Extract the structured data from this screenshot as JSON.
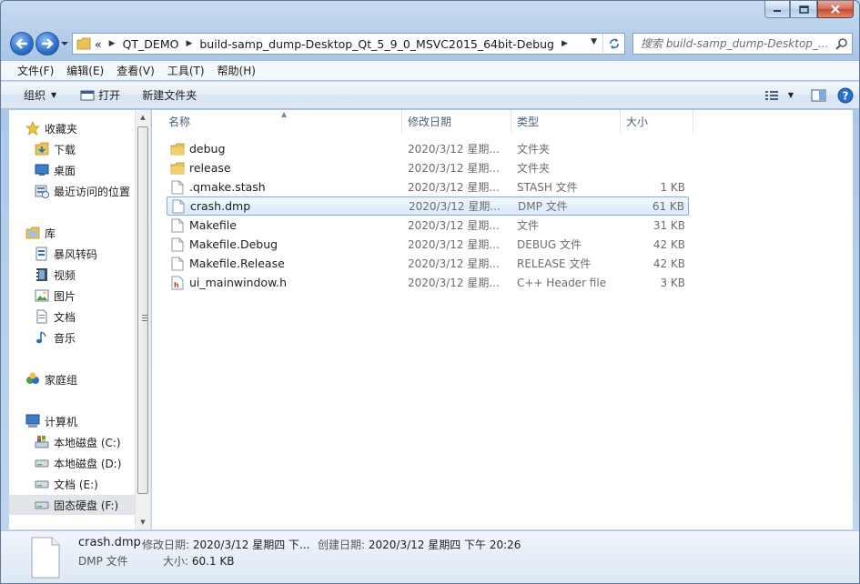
{
  "window": {
    "caption": {
      "minimize": "minimize",
      "maximize": "maximize",
      "close": "close"
    }
  },
  "address": {
    "overflow": "«",
    "crumbs": [
      "QT_DEMO",
      "build-samp_dump-Desktop_Qt_5_9_0_MSVC2015_64bit-Debug"
    ],
    "separator": "▶",
    "dropdown": "▼"
  },
  "search": {
    "placeholder": "搜索 build-samp_dump-Desktop_..."
  },
  "menu": [
    "文件(F)",
    "编辑(E)",
    "查看(V)",
    "工具(T)",
    "帮助(H)"
  ],
  "commands": {
    "organize": "组织",
    "organize_arrow": "▼",
    "open": "打开",
    "new_folder": "新建文件夹",
    "views_arrow": "▼"
  },
  "nav": {
    "favorites_header": "收藏夹",
    "favorites": [
      "下载",
      "桌面",
      "最近访问的位置"
    ],
    "libraries_header": "库",
    "libraries": [
      "暴风转码",
      "视频",
      "图片",
      "文档",
      "音乐"
    ],
    "homegroup": "家庭组",
    "computer_header": "计算机",
    "drives": [
      "本地磁盘 (C:)",
      "本地磁盘 (D:)",
      "文档 (E:)",
      "固态硬盘 (F:)"
    ],
    "selected_drive": "固态硬盘 (F:)",
    "scroll_up": "▲",
    "scroll_down": "▼"
  },
  "columns": {
    "name": "名称",
    "date": "修改日期",
    "type": "类型",
    "size": "大小",
    "sort_arrow": "▲"
  },
  "files": [
    {
      "name": "debug",
      "date": "2020/3/12 星期...",
      "type": "文件夹",
      "size": "",
      "icon": "folder-icon"
    },
    {
      "name": "release",
      "date": "2020/3/12 星期...",
      "type": "文件夹",
      "size": "",
      "icon": "folder-icon"
    },
    {
      "name": ".qmake.stash",
      "date": "2020/3/12 星期...",
      "type": "STASH 文件",
      "size": "1 KB",
      "icon": "file-icon"
    },
    {
      "name": "crash.dmp",
      "date": "2020/3/12 星期...",
      "type": "DMP 文件",
      "size": "61 KB",
      "icon": "file-icon",
      "selected": true
    },
    {
      "name": "Makefile",
      "date": "2020/3/12 星期...",
      "type": "文件",
      "size": "31 KB",
      "icon": "file-icon"
    },
    {
      "name": "Makefile.Debug",
      "date": "2020/3/12 星期...",
      "type": "DEBUG 文件",
      "size": "42 KB",
      "icon": "file-icon"
    },
    {
      "name": "Makefile.Release",
      "date": "2020/3/12 星期...",
      "type": "RELEASE 文件",
      "size": "42 KB",
      "icon": "file-icon"
    },
    {
      "name": "ui_mainwindow.h",
      "date": "2020/3/12 星期...",
      "type": "C++ Header file",
      "size": "3 KB",
      "icon": "header-file-icon"
    }
  ],
  "details": {
    "name": "crash.dmp",
    "type": "DMP 文件",
    "modified_label": "修改日期:",
    "modified_value": "2020/3/12 星期四 下...",
    "created_label": "创建日期:",
    "created_value": "2020/3/12 星期四 下午 20:26",
    "size_label": "大小:",
    "size_value": "60.1 KB"
  },
  "colors": {
    "accent": "#2a6fc7",
    "selection_border": "#84acdd",
    "folder": "#e9c25a"
  }
}
